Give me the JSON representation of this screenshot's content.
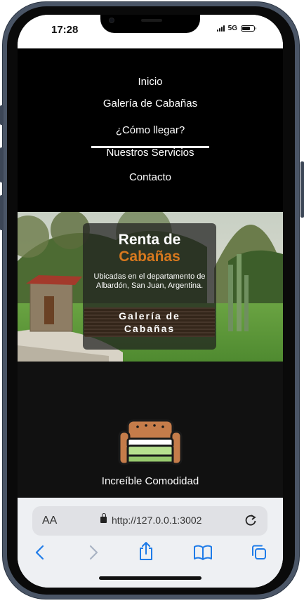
{
  "status": {
    "time": "17:28",
    "network": "5G",
    "battery_level": 0.75
  },
  "nav": {
    "items": [
      "Inicio",
      "Galería de Cabañas",
      "¿Cómo llegar?",
      "Nuestros Servicios",
      "Contacto"
    ],
    "active_index": 1
  },
  "hero": {
    "title_line1": "Renta de",
    "title_line2": "Cabañas",
    "subtitle": "Ubicadas en el departamento de Albardón, San Juan, Argentina.",
    "button_line1": "Galería de",
    "button_line2": "Cabañas"
  },
  "features": {
    "first_label": "Increíble Comodidad",
    "icon": "bed-icon"
  },
  "browser": {
    "aa_label": "AA",
    "url": "http://127.0.0.1:3002"
  },
  "colors": {
    "accent": "#d7781e",
    "nav_bg": "#000000",
    "section_bg": "#111111"
  }
}
